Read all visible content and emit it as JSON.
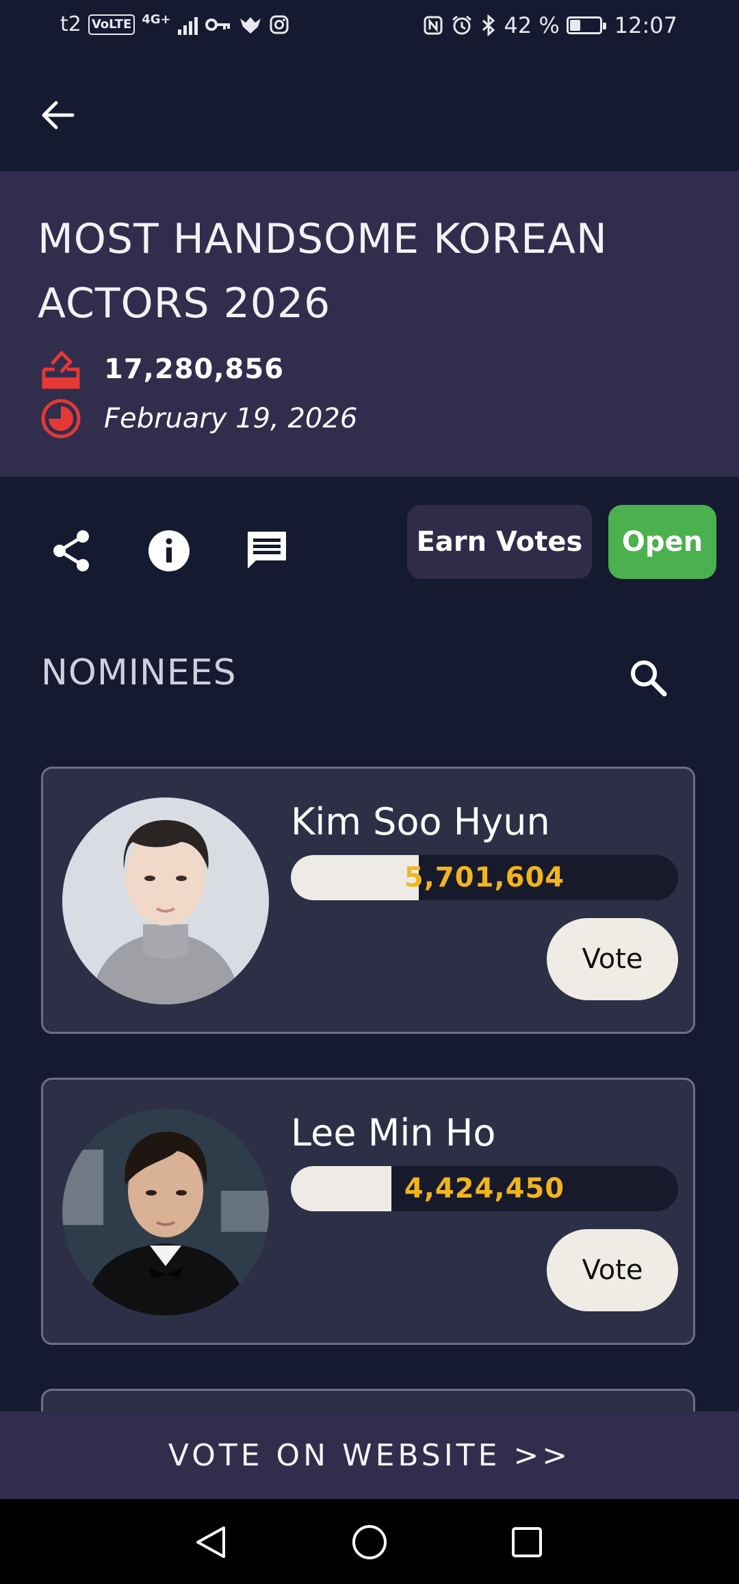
{
  "status_bar": {
    "carrier": "t2",
    "volte": "VoLTE",
    "network": "4G+",
    "battery": "42 %",
    "battery_level": 0.42,
    "time": "12:07",
    "icons": [
      "key-icon",
      "bird-icon",
      "instagram-icon",
      "nfc-icon",
      "alarm-icon",
      "bluetooth-icon",
      "battery-icon"
    ]
  },
  "header": {
    "title": "MOST HANDSOME KOREAN ACTORS 2026",
    "total_votes": "17,280,856",
    "date": "February 19, 2026",
    "accent_color": "#e53935"
  },
  "actions": {
    "earn_votes": "Earn Votes",
    "open": "Open",
    "icons": [
      "share-icon",
      "info-icon",
      "comment-icon"
    ]
  },
  "nominees_heading": "NOMINEES",
  "nominees": [
    {
      "name": "Kim Soo Hyun",
      "votes": "5,701,604",
      "share": 0.33,
      "vote_label": "Vote"
    },
    {
      "name": "Lee Min Ho",
      "votes": "4,424,450",
      "share": 0.26,
      "vote_label": "Vote"
    }
  ],
  "footer": {
    "label": "VOTE ON WEBSITE >>"
  },
  "colors": {
    "background": "#161a30",
    "header": "#312d4d",
    "card": "#2c2f45",
    "open": "#4bb04e",
    "count": "#f3b51a"
  }
}
